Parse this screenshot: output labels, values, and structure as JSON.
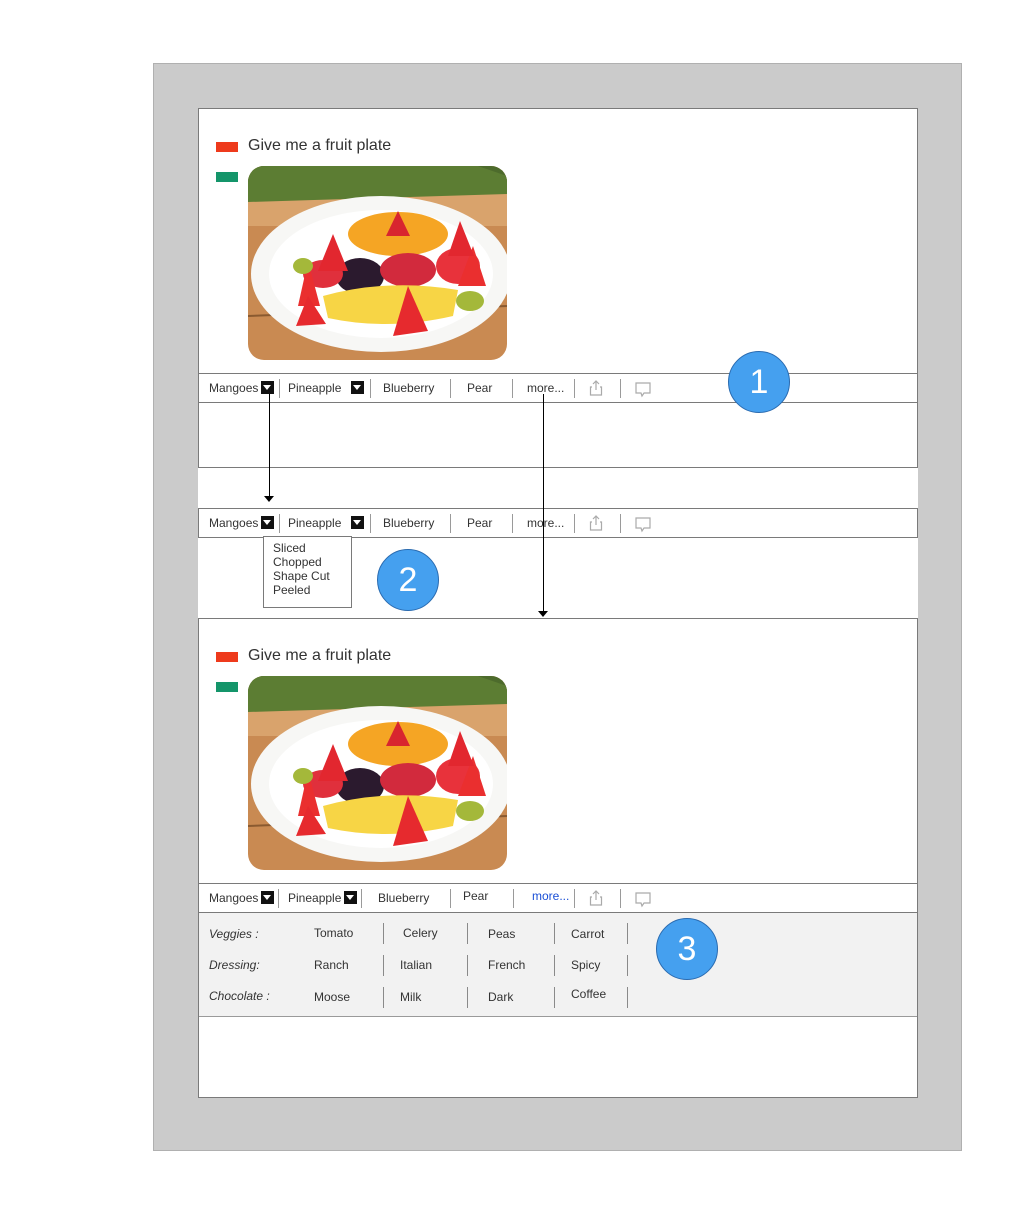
{
  "prompt": {
    "text": "Give me a fruit plate",
    "user_color": "#ee3a1c",
    "assistant_color": "#14956a"
  },
  "image": {
    "alt": "Fruit plate with strawberries, oranges, blackberries, raspberries, mango and kiwi"
  },
  "toolbar": {
    "items": [
      {
        "label": "Mangoes",
        "has_dropdown": true
      },
      {
        "label": "Pineapple",
        "has_dropdown": true
      },
      {
        "label": "Blueberry",
        "has_dropdown": false
      },
      {
        "label": "Pear",
        "has_dropdown": false
      },
      {
        "label": "more...",
        "has_dropdown": false
      }
    ],
    "icons": [
      "share-icon",
      "comment-icon"
    ]
  },
  "dropdown": {
    "options": [
      "Sliced",
      "Chopped",
      "Shape Cut",
      "Peeled"
    ]
  },
  "steps": [
    "1",
    "2",
    "3"
  ],
  "more_options": {
    "rows": [
      {
        "label": "Veggies :",
        "values": [
          "Tomato",
          "Celery",
          "Peas",
          "Carrot"
        ]
      },
      {
        "label": "Dressing:",
        "values": [
          "Ranch",
          "Italian",
          "French",
          "Spicy"
        ]
      },
      {
        "label": "Chocolate :",
        "values": [
          "Moose",
          "Milk",
          "Dark",
          "Coffee"
        ]
      }
    ]
  },
  "colors": {
    "badge": "#45a0ef",
    "link": "#1a4fd6",
    "canvas": "#cbcbcb",
    "options_bg": "#f2f2f2"
  }
}
